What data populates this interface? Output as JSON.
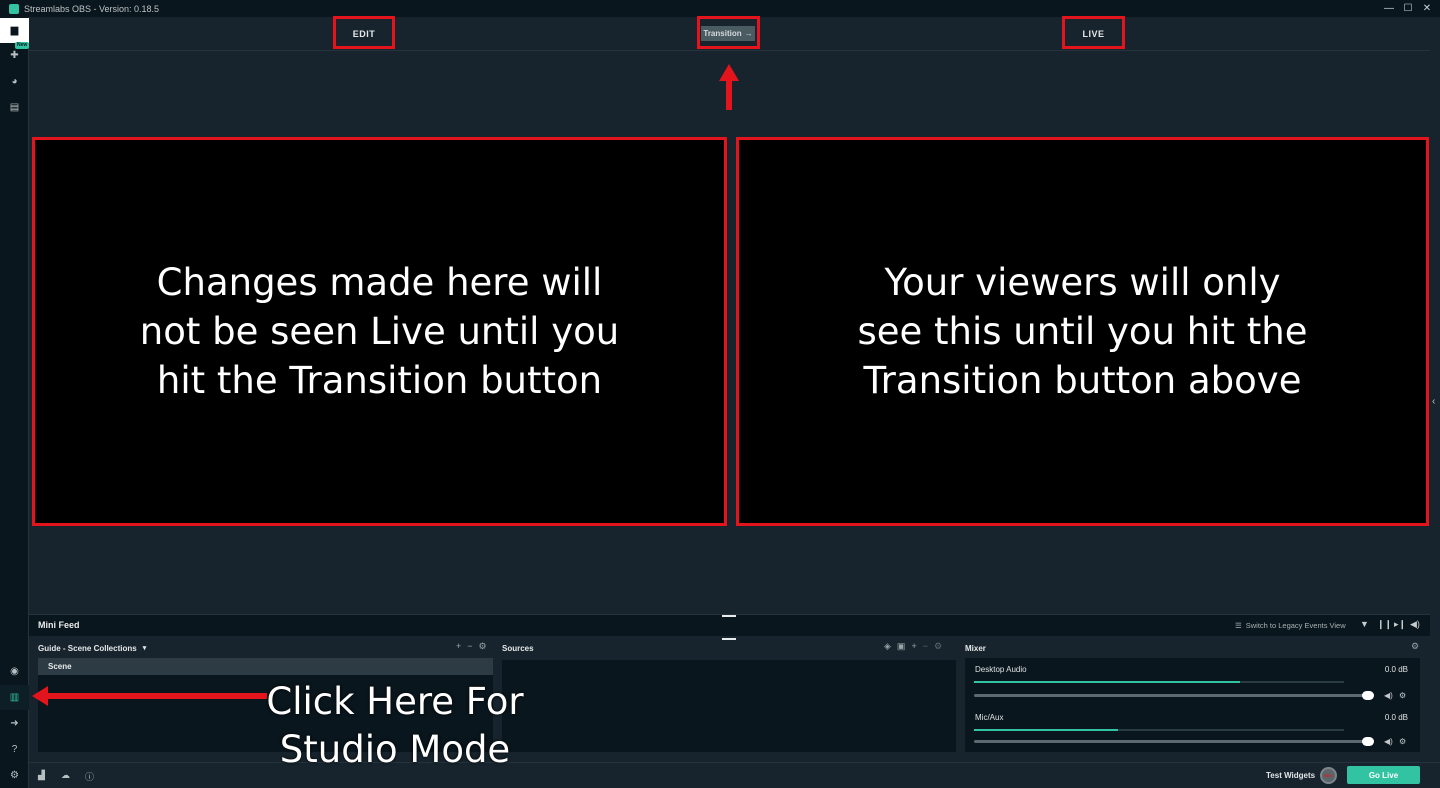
{
  "window": {
    "title": "Streamlabs OBS - Version: 0.18.5",
    "minimize": "—",
    "maximize": "☐",
    "close": "✕"
  },
  "sidebar": {
    "new_badge": "New"
  },
  "studio": {
    "edit_label": "EDIT",
    "transition_label": "Transition",
    "transition_arrow": "→",
    "live_label": "LIVE",
    "edit_pane_text": "Changes made here will not be seen Live until you hit the Transition button",
    "live_pane_text": "Your viewers will only see this until you hit the Transition button above"
  },
  "minifeed": {
    "title": "Mini Feed",
    "legacy_link": "Switch to Legacy Events View"
  },
  "scenes": {
    "header": "Guide - Scene Collections",
    "items": [
      "Scene"
    ]
  },
  "sources": {
    "header": "Sources"
  },
  "mixer": {
    "header": "Mixer",
    "channels": [
      {
        "name": "Desktop Audio",
        "db": "0.0 dB",
        "volume": 1.0,
        "meter_level": 0.72
      },
      {
        "name": "Mic/Aux",
        "db": "0.0 dB",
        "volume": 1.0,
        "meter_level": 0.39
      }
    ]
  },
  "footer": {
    "test_widgets": "Test Widgets",
    "rec": "REC",
    "go_live": "Go Live"
  },
  "annotation": {
    "studio_mode_hint_line1": "Click Here For",
    "studio_mode_hint_line2": "Studio Mode"
  },
  "colors": {
    "accent": "#31c3a2",
    "highlight": "#e3141c",
    "background": "#17242d",
    "dark": "#09161d"
  }
}
